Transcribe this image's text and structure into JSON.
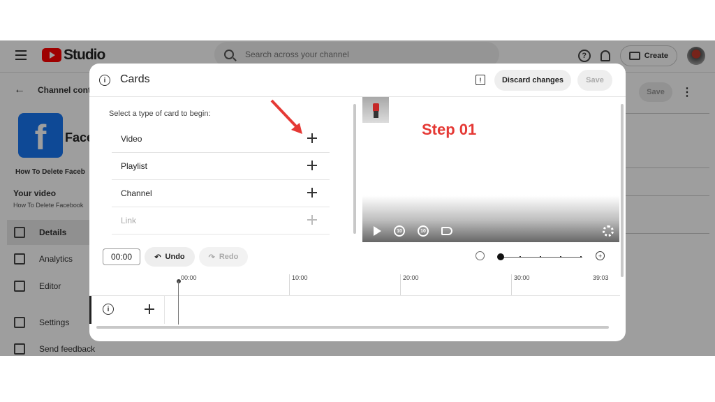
{
  "studio": {
    "logo_text": "Studio",
    "search_placeholder": "Search across your channel",
    "help_glyph": "?",
    "create_label": "Create",
    "back_label": "Channel cont",
    "video_thumb_letter": "f",
    "video_title_partial": "Face",
    "video_title_line": "How To Delete Faceb",
    "your_video_label": "Your video",
    "your_video_sub": "How To Delete Facebook",
    "bg_save_label": "Save",
    "nav": [
      {
        "label": "Details",
        "icon": "pencil-icon"
      },
      {
        "label": "Analytics",
        "icon": "analytics-icon"
      },
      {
        "label": "Editor",
        "icon": "editor-icon"
      },
      {
        "label": "Settings",
        "icon": "gear-icon"
      },
      {
        "label": "Send feedback",
        "icon": "feedback-icon"
      }
    ]
  },
  "modal": {
    "title": "Cards",
    "discard_label": "Discard changes",
    "save_label": "Save",
    "prompt": "Select a type of card to begin:",
    "card_types": [
      {
        "label": "Video",
        "enabled": true
      },
      {
        "label": "Playlist",
        "enabled": true
      },
      {
        "label": "Channel",
        "enabled": true
      },
      {
        "label": "Link",
        "enabled": false
      }
    ],
    "annotation": "Step 01",
    "skip_back": "10",
    "skip_fwd": "10",
    "time_value": "00:00",
    "undo_label": "Undo",
    "redo_label": "Redo",
    "timeline_ticks": [
      "00:00",
      "10:00",
      "20:00",
      "30:00",
      "39:03"
    ]
  },
  "colors": {
    "accent_red": "#e53935",
    "youtube_red": "#ff0000",
    "facebook_blue": "#1877f2"
  }
}
